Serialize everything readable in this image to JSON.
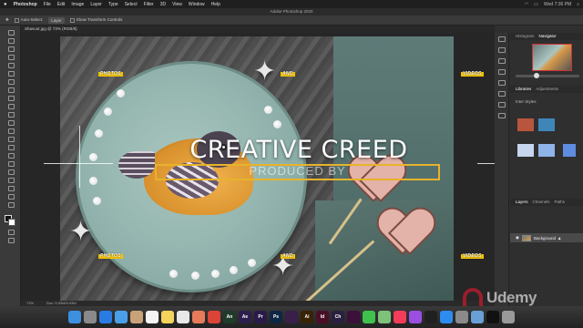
{
  "menubar": {
    "apple": "",
    "app": "Photoshop",
    "items": [
      "File",
      "Edit",
      "Image",
      "Layer",
      "Type",
      "Select",
      "Filter",
      "3D",
      "View",
      "Window",
      "Help"
    ],
    "clock": "Wed 7:36 PM"
  },
  "window_title": "Adobe Photoshop 2020",
  "options_bar": {
    "auto_select": "Auto-Select:",
    "layer": "Layer",
    "transform_controls": "Show Transform Controls"
  },
  "document_tab": "Shavuot.jpg @ 73% (RGB/8)",
  "artwork": {
    "title": "CREATIVE CREED",
    "subtitle": "PRODUCED BY",
    "tag_photos_top": "PHOTOS",
    "tag_and_top": "AND",
    "tag_videos_top": "VIDEOS",
    "tag_photos_bottom": "PHOTOS",
    "tag_and_bottom": "AND",
    "tag_videos_bottom": "VIDEOS",
    "tag_color": "#f2c200",
    "frame_color": "#e7b32a"
  },
  "right_panel": {
    "top_tabs": [
      "Histogram",
      "Navigator"
    ],
    "mid_tabs": [
      "Libraries",
      "Adjustments"
    ],
    "library_label": "Inter Styles",
    "layer_tabs": [
      "Layers",
      "Channels",
      "Paths"
    ],
    "layer_name": "Background",
    "swatches": [
      "#b8563d",
      "#3f86b8",
      "#c7d5ee",
      "#8fb4ea",
      "#5e8ce0"
    ]
  },
  "status_bar": {
    "zoom": "73%",
    "doc": "Doc: 5.93M/5.93M"
  },
  "udemy": "Udemy",
  "dock_icons": [
    {
      "name": "finder",
      "label": "",
      "color": "#3d8fe0"
    },
    {
      "name": "launchpad",
      "label": "",
      "color": "#8a8a8a"
    },
    {
      "name": "safari",
      "label": "",
      "color": "#2a7be4"
    },
    {
      "name": "mail",
      "label": "",
      "color": "#4aa0e8"
    },
    {
      "name": "contacts",
      "label": "",
      "color": "#c9a27a"
    },
    {
      "name": "calendar",
      "label": "",
      "color": "#f4f4f4"
    },
    {
      "name": "notes",
      "label": "",
      "color": "#f5d45c"
    },
    {
      "name": "reminders",
      "label": "",
      "color": "#e9e9e9"
    },
    {
      "name": "photos",
      "label": "",
      "color": "#e57b5a"
    },
    {
      "name": "chrome",
      "label": "",
      "color": "#db4437"
    },
    {
      "name": "animate",
      "label": "An",
      "color": "#1f3b2a"
    },
    {
      "name": "after-effects",
      "label": "Ae",
      "color": "#2d1f4d"
    },
    {
      "name": "premiere",
      "label": "Pr",
      "color": "#2a1a4a"
    },
    {
      "name": "photoshop",
      "label": "Ps",
      "color": "#0d2744"
    },
    {
      "name": "media-encoder",
      "label": "",
      "color": "#3a1f4a"
    },
    {
      "name": "illustrator",
      "label": "Ai",
      "color": "#3a2205"
    },
    {
      "name": "indesign",
      "label": "Id",
      "color": "#4a0f26"
    },
    {
      "name": "character-animator",
      "label": "Ch",
      "color": "#2a1f40"
    },
    {
      "name": "xd",
      "label": "",
      "color": "#3a0f3a"
    },
    {
      "name": "messages",
      "label": "",
      "color": "#3fc14e"
    },
    {
      "name": "maps",
      "label": "",
      "color": "#7ec27a"
    },
    {
      "name": "music",
      "label": "",
      "color": "#f23c5a"
    },
    {
      "name": "podcasts",
      "label": "",
      "color": "#9a4fe0"
    },
    {
      "name": "tv",
      "label": "",
      "color": "#202020"
    },
    {
      "name": "app-store",
      "label": "",
      "color": "#2d8cf0"
    },
    {
      "name": "system-preferences",
      "label": "",
      "color": "#8a8a8a"
    },
    {
      "name": "preview",
      "label": "",
      "color": "#6aa0d8"
    },
    {
      "name": "terminal",
      "label": "",
      "color": "#111111"
    },
    {
      "name": "trash",
      "label": "",
      "color": "#9a9a9a"
    }
  ]
}
